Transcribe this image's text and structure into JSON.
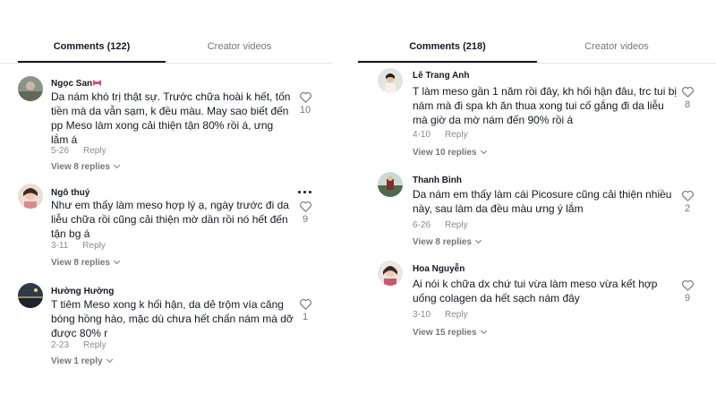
{
  "left": {
    "tabs": {
      "comments": "Comments (122)",
      "creator": "Creator videos"
    },
    "comments": [
      {
        "username": "Ngọc San",
        "text": "Da nám khó trị thật sự. Trước chữa hoài k hết, tốn tiền mà da vẫn sạm, k đều màu. May sao biết đến pp Meso làm xong cải thiện tận 80% rồi á, ưng lắm á",
        "date": "5-26",
        "reply": "Reply",
        "view": "View 8 replies",
        "likes": "10"
      },
      {
        "username": "Ngô thuý",
        "text": "Như em thấy làm meso hợp lý ạ, ngày trước đi da liễu chữa rồi cũng cải thiện mờ dần rồi nó hết đến tận bg á",
        "date": "3-11",
        "reply": "Reply",
        "view": "View 8 replies",
        "likes": "9"
      },
      {
        "username": "Hường Hường",
        "text": "T tiêm Meso xong k hối hận, da dẻ trộm vía căng bóng hồng hào, mặc dù chưa hết chấn nám mà dỡ được 80% r",
        "date": "2-23",
        "reply": "Reply",
        "view": "View 1 reply",
        "likes": "1"
      }
    ]
  },
  "right": {
    "tabs": {
      "comments": "Comments (218)",
      "creator": "Creator videos"
    },
    "comments": [
      {
        "username": "Lê Trang Anh",
        "text": "T làm meso gần 1 năm rồi đây, kh hối hận đâu, trc tui bị nám mà đi spa kh ăn thua xong tui cố gắng đi da liễu mà giờ da mờ nám đến 90% rồi á",
        "date": "4-10",
        "reply": "Reply",
        "view": "View 10 replies",
        "likes": "8"
      },
      {
        "username": "Thanh Bình",
        "text": "Da nám em thấy làm cái Picosure cũng cải thiện nhiều này, sau làm da đều màu ưng ý lắm",
        "date": "6-26",
        "reply": "Reply",
        "view": "View 8 replies",
        "likes": "2"
      },
      {
        "username": "Hoa Nguyễn",
        "text": "Ai nói k chữa dx chứ tui vừa làm meso vừa kết hợp uống colagen da hết sạch nám đây",
        "date": "3-10",
        "reply": "Reply",
        "view": "View 15 replies",
        "likes": "9"
      }
    ]
  },
  "colors": {
    "text": "#161823",
    "muted": "#8a8b91",
    "divider": "#e3e3e4",
    "heart": "#75767c"
  },
  "icons": {
    "like": "heart-outline-icon",
    "more": "more-dots-icon",
    "chevron": "chevron-down-icon",
    "emoji": "bow-emoji-icon"
  }
}
